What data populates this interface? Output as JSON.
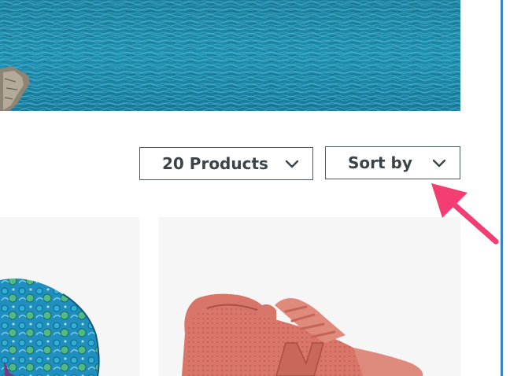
{
  "hero": {
    "image": "ocean-water-banner"
  },
  "toolbar": {
    "products_per_page_label": "20 Products",
    "sort_label": "Sort by"
  },
  "products": [
    {
      "image": "patterned-backpack"
    },
    {
      "image": "pink-sneaker"
    }
  ],
  "icons": {
    "chevron": "chevron-down-icon",
    "annotation": "pink-arrow-pointer"
  },
  "colors": {
    "border": "#4a5a63",
    "label": "#3b4348",
    "card_bg": "#f6f6f7",
    "arrow": "#f43d72",
    "ocean": "#1b8aa8"
  }
}
